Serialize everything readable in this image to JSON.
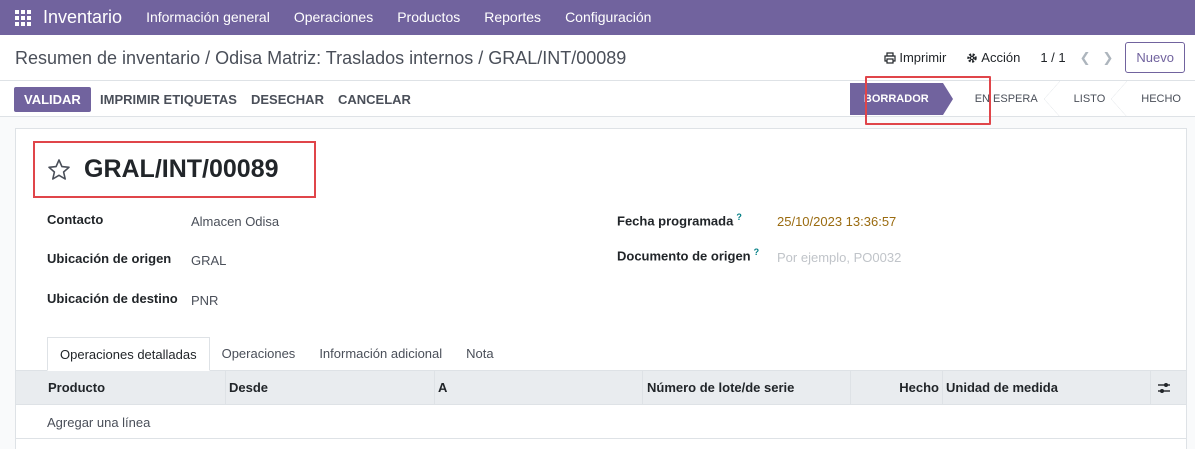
{
  "navbar": {
    "brand": "Inventario",
    "menu": [
      "Información general",
      "Operaciones",
      "Productos",
      "Reportes",
      "Configuración"
    ]
  },
  "control_panel": {
    "breadcrumb": "Resumen de inventario / Odisa Matriz: Traslados internos / GRAL/INT/00089",
    "print_label": "Imprimir",
    "action_label": "Acción",
    "pager": "1 / 1",
    "new_label": "Nuevo"
  },
  "actions": {
    "validate": "VALIDAR",
    "print_labels": "IMPRIMIR ETIQUETAS",
    "scrap": "DESECHAR",
    "cancel": "CANCELAR"
  },
  "status_bar": {
    "stages": [
      "BORRADOR",
      "EN ESPERA",
      "LISTO",
      "HECHO"
    ],
    "active": "BORRADOR"
  },
  "record": {
    "title": "GRAL/INT/00089",
    "fields": {
      "contact_label": "Contacto",
      "contact_value": "Almacen Odisa",
      "source_loc_label": "Ubicación de origen",
      "source_loc_value": "GRAL",
      "dest_loc_label": "Ubicación de destino",
      "dest_loc_value": "PNR",
      "scheduled_label": "Fecha programada",
      "scheduled_value": "25/10/2023 13:36:57",
      "origin_doc_label": "Documento de origen",
      "origin_doc_placeholder": "Por ejemplo, PO0032",
      "help_mark": "?"
    }
  },
  "tabs": [
    "Operaciones detalladas",
    "Operaciones",
    "Información adicional",
    "Nota"
  ],
  "table": {
    "columns": [
      "Producto",
      "Desde",
      "A",
      "Número de lote/de serie",
      "Hecho",
      "Unidad de medida"
    ],
    "add_line": "Agregar una línea"
  },
  "colors": {
    "brand": "#71639e",
    "highlight": "#e0454a"
  }
}
